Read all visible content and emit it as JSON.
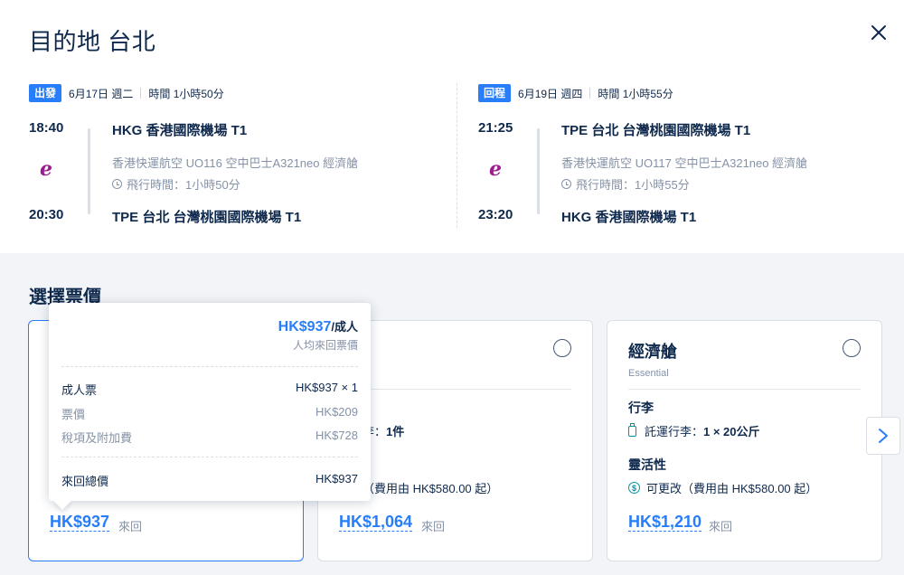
{
  "title": "目的地 台北",
  "outbound": {
    "tag": "出發",
    "date": "6月17日 週二",
    "duration_label": "時間 1小時50分",
    "dep_time": "18:40",
    "dep_airport": "HKG 香港國際機場 T1",
    "carrier_info": "香港快運航空 UO116 空中巴士A321neo 經濟艙",
    "flight_time": "飛行時間：1小時50分",
    "arr_time": "20:30",
    "arr_airport": "TPE 台北 台灣桃園國際機場 T1",
    "logo": "e"
  },
  "return": {
    "tag": "回程",
    "date": "6月19日 週四",
    "duration_label": "時間 1小時55分",
    "dep_time": "21:25",
    "dep_airport": "TPE 台北 台灣桃園國際機場 T1",
    "carrier_info": "香港快運航空 UO117 空中巴士A321neo 經濟艙",
    "flight_time": "飛行時間：1小時55分",
    "arr_time": "23:20",
    "arr_airport": "HKG 香港國際機場 T1",
    "logo": "e"
  },
  "fares_title": "選擇票價",
  "fares": [
    {
      "price": "HK$937",
      "suffix": "來回"
    },
    {
      "cabin": "艙",
      "baggage_text": "提行李：",
      "baggage_value": "1件",
      "flex_head": "性",
      "flex_text": "更改（費用由 HK$580.00 起）",
      "price": "HK$1,064",
      "suffix": "來回"
    },
    {
      "cabin": "經濟艙",
      "fare_name": "Essential",
      "baggage_head": "行李",
      "baggage_text": "託運行李：",
      "baggage_value": "1 × 20公斤",
      "flex_head": "靈活性",
      "flex_text": "可更改（費用由 HK$580.00 起）",
      "price": "HK$1,210",
      "suffix": "來回"
    }
  ],
  "tooltip": {
    "price": "HK$937",
    "per": "/成人",
    "note": "人均來回票價",
    "rows": [
      {
        "label": "成人票",
        "value": "HK$937 × 1"
      },
      {
        "label": "票價",
        "value": "HK$209"
      },
      {
        "label": "稅項及附加費",
        "value": "HK$728"
      }
    ],
    "total_label": "來回總價",
    "total_value": "HK$937"
  },
  "icons": {
    "close": "close-icon",
    "clock": "clock-icon",
    "baggage": "luggage-icon",
    "flex": "dollar-circle-icon",
    "next": "chevron-right-icon"
  },
  "colors": {
    "accent": "#287dfa",
    "text": "#0f294d",
    "muted": "#8592a6",
    "teal": "#05939f",
    "airline": "#9b1d8f"
  }
}
